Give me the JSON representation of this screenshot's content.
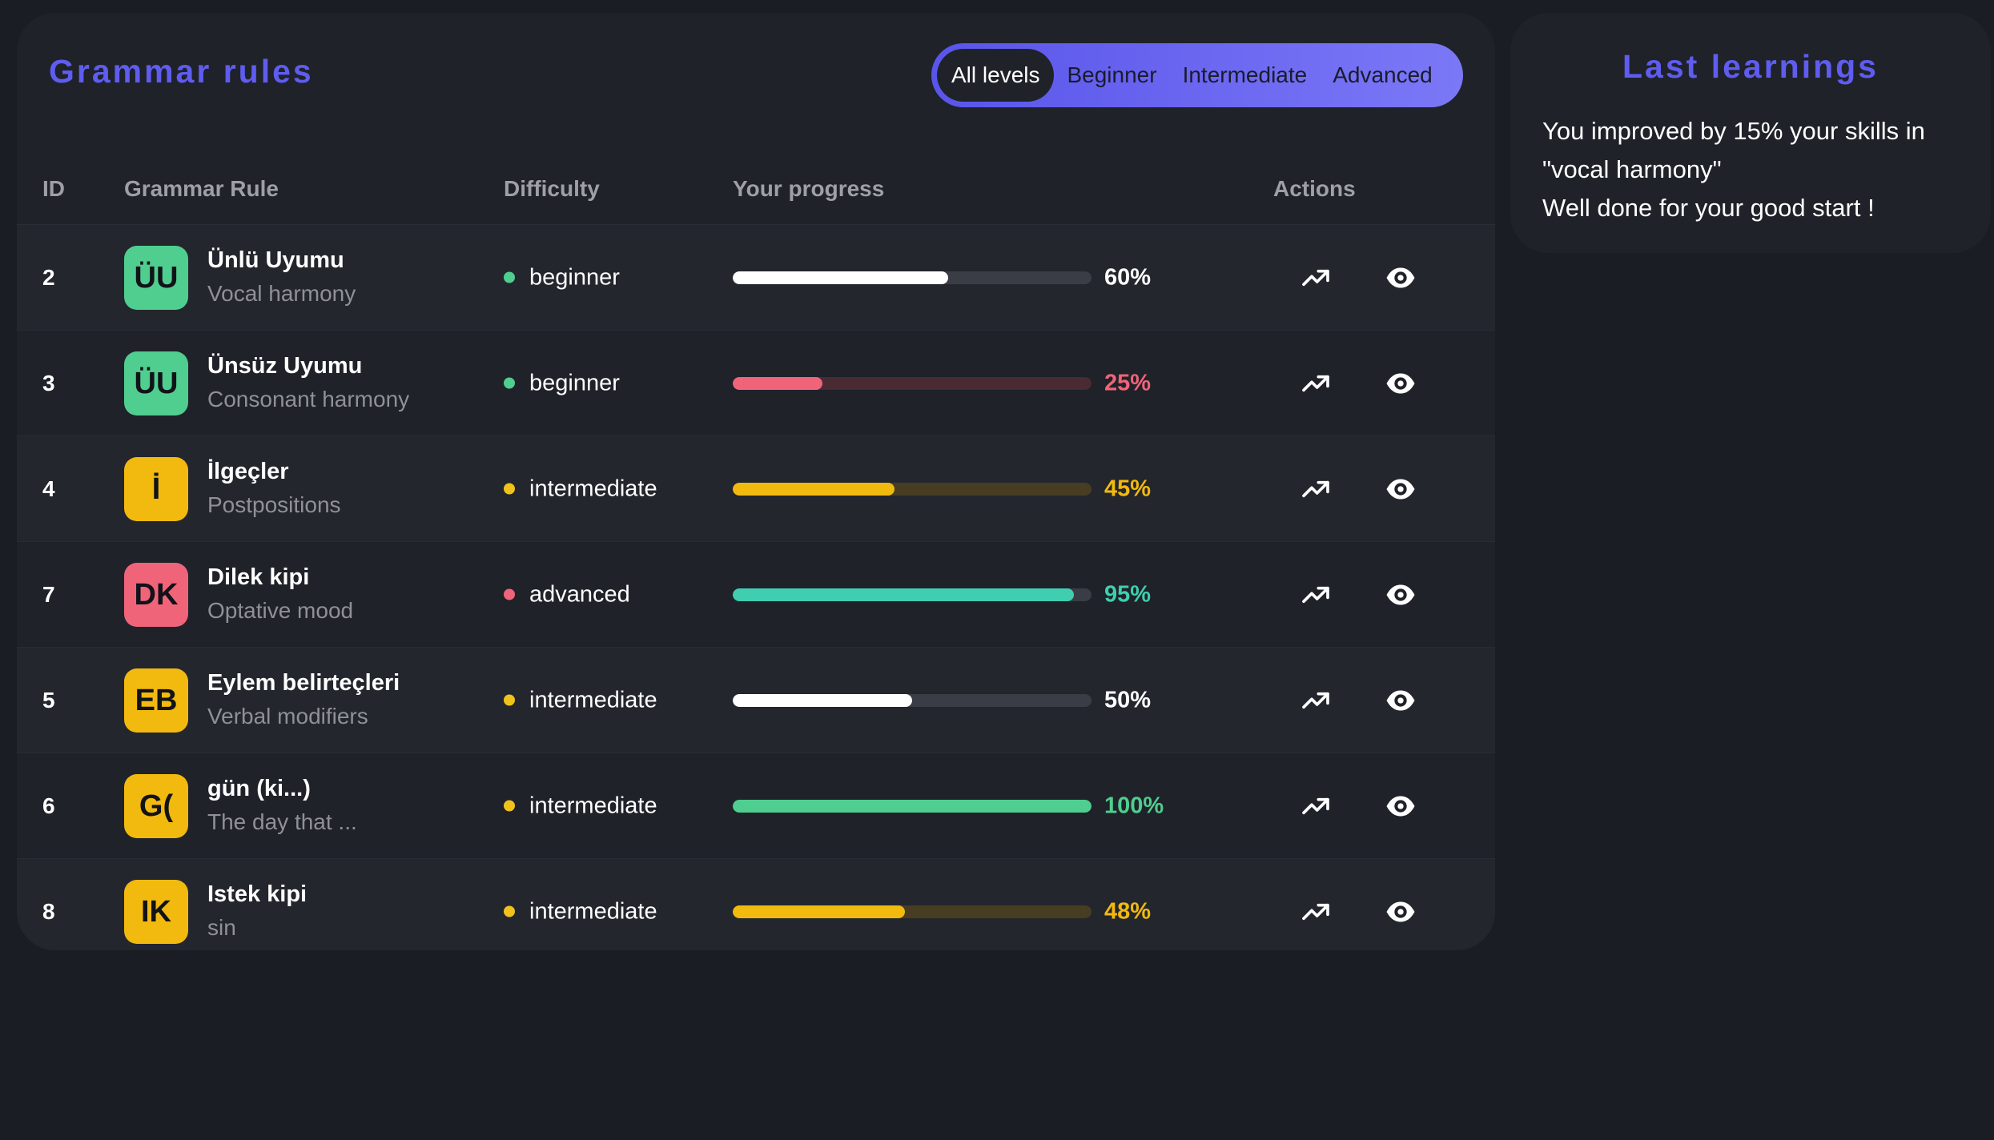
{
  "main": {
    "title": "Grammar rules",
    "filters": [
      "All levels",
      "Beginner",
      "Intermediate",
      "Advanced"
    ],
    "active_filter": "All levels",
    "columns": {
      "id": "ID",
      "rule": "Grammar Rule",
      "difficulty": "Difficulty",
      "progress": "Your progress",
      "actions": "Actions"
    },
    "rows": [
      {
        "id": "2",
        "badge": "ÜU",
        "badge_color": "#4fce8f",
        "name": "Ünlü Uyumu",
        "translation": "Vocal harmony",
        "difficulty": "beginner",
        "dot_color": "#4fce8f",
        "progress": 60,
        "progress_label": "60%",
        "bar_color": "#ffffff",
        "track_color": "#3a3d45",
        "pct_color": "#ffffff"
      },
      {
        "id": "3",
        "badge": "ÜU",
        "badge_color": "#4fce8f",
        "name": "Ünsüz Uyumu",
        "translation": "Consonant harmony",
        "difficulty": "beginner",
        "dot_color": "#4fce8f",
        "progress": 25,
        "progress_label": "25%",
        "bar_color": "#f0647a",
        "track_color": "#4a2a33",
        "pct_color": "#f0647a"
      },
      {
        "id": "4",
        "badge": "İ",
        "badge_color": "#f2b90f",
        "name": "İlgeçler",
        "translation": "Postpositions",
        "difficulty": "intermediate",
        "dot_color": "#f2c21c",
        "progress": 45,
        "progress_label": "45%",
        "bar_color": "#f2b90f",
        "track_color": "#463d22",
        "pct_color": "#f2b90f"
      },
      {
        "id": "7",
        "badge": "DK",
        "badge_color": "#f0647a",
        "name": "Dilek kipi",
        "translation": "Optative mood",
        "difficulty": "advanced",
        "dot_color": "#f0647a",
        "progress": 95,
        "progress_label": "95%",
        "bar_color": "#3fcfb0",
        "track_color": "#3a3d45",
        "pct_color": "#3fcfb0"
      },
      {
        "id": "5",
        "badge": "EB",
        "badge_color": "#f2b90f",
        "name": "Eylem belirteçleri",
        "translation": "Verbal modifiers",
        "difficulty": "intermediate",
        "dot_color": "#f2c21c",
        "progress": 50,
        "progress_label": "50%",
        "bar_color": "#ffffff",
        "track_color": "#3a3d45",
        "pct_color": "#ffffff"
      },
      {
        "id": "6",
        "badge": "G(",
        "badge_color": "#f2b90f",
        "name": "gün (ki...)",
        "translation": "The day that ...",
        "difficulty": "intermediate",
        "dot_color": "#f2c21c",
        "progress": 100,
        "progress_label": "100%",
        "bar_color": "#4fce8f",
        "track_color": "#3a3d45",
        "pct_color": "#4fce8f"
      },
      {
        "id": "8",
        "badge": "IK",
        "badge_color": "#f2b90f",
        "name": "Istek kipi",
        "translation": "sin",
        "difficulty": "intermediate",
        "dot_color": "#f2c21c",
        "progress": 48,
        "progress_label": "48%",
        "bar_color": "#f2b90f",
        "track_color": "#463d22",
        "pct_color": "#f2b90f"
      }
    ],
    "row_icons": [
      "trend-up-icon",
      "eye-icon"
    ]
  },
  "side": {
    "title": "Last learnings",
    "line1": "You improved by 15% your skills in \"vocal harmony\"",
    "line2": "Well done for your good start !"
  },
  "colors": {
    "background": "#1b1d24",
    "panel": "#1f2229",
    "accent": "#5f5cf0"
  }
}
